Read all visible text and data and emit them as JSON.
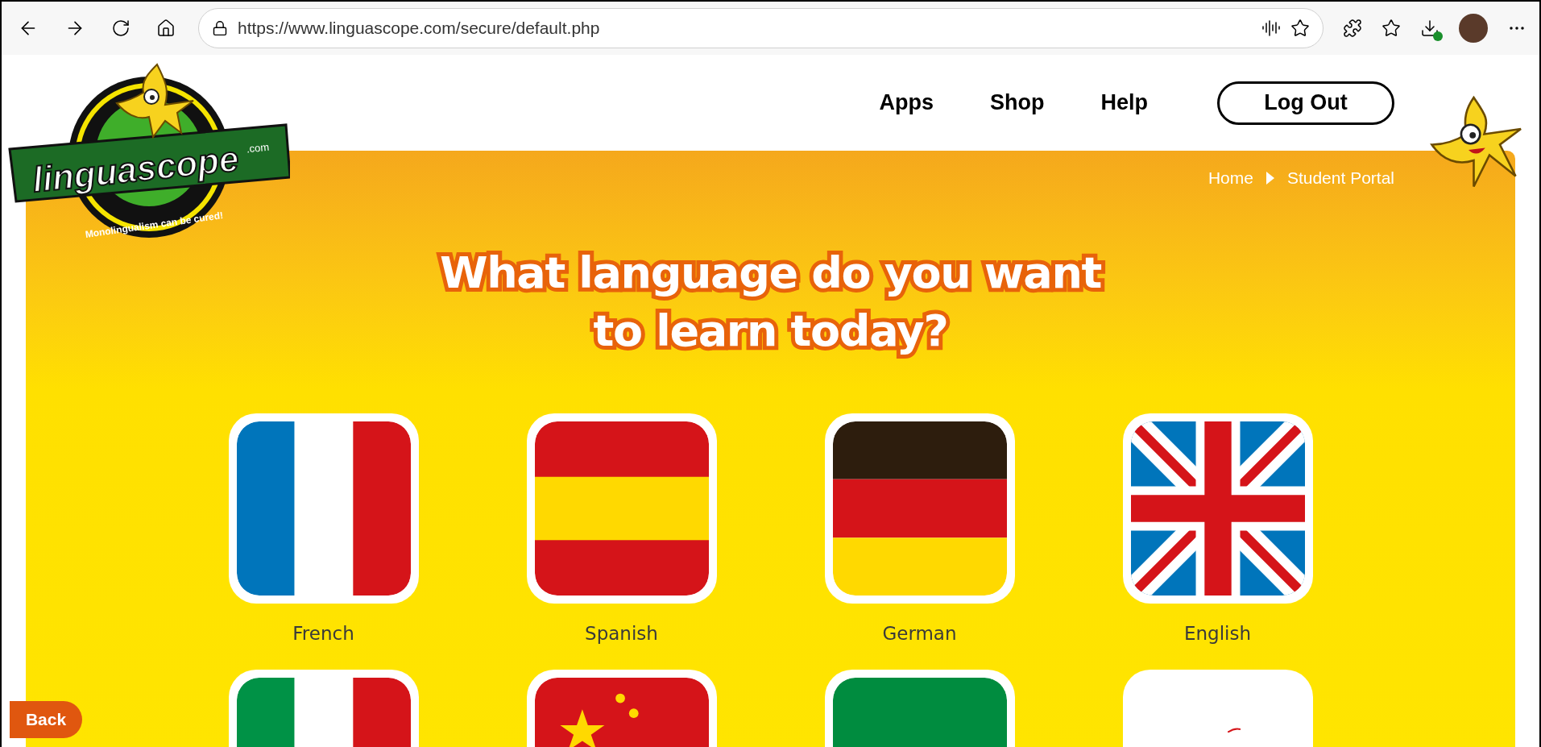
{
  "browser": {
    "url": "https://www.linguascope.com/secure/default.php"
  },
  "logo": {
    "name": "linguascope",
    "suffix": ".com",
    "tagline": "Monolingualism can be cured!"
  },
  "nav": [
    {
      "label": "Apps"
    },
    {
      "label": "Shop"
    },
    {
      "label": "Help"
    }
  ],
  "logout_button": "Log Out",
  "breadcrumb": [
    "Home",
    "Student Portal"
  ],
  "heading": [
    "What language do you want",
    "to learn today?"
  ],
  "languages": [
    {
      "kind": "fr",
      "label": "French"
    },
    {
      "kind": "es",
      "label": "Spanish"
    },
    {
      "kind": "de",
      "label": "German"
    },
    {
      "kind": "gb",
      "label": "English"
    },
    {
      "kind": "it"
    },
    {
      "kind": "cn"
    },
    {
      "kind": "green"
    },
    {
      "kind": "white"
    }
  ],
  "back_button": "Back"
}
